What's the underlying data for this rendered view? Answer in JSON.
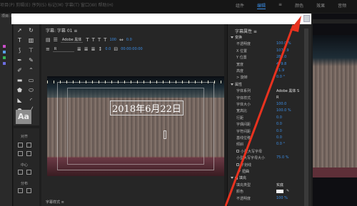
{
  "window": {
    "top_dim_text": "项目(P) 剪辑(E) 序列(S) 标记(M) 字幕(T) 窗口(W) 帮助(H)",
    "workspaces": [
      "组件",
      "编辑",
      "颜色",
      "效果",
      "音频"
    ],
    "active_workspace": "编辑",
    "workspace_menu_glyph": "≡",
    "overflow_glyph": "»"
  },
  "left_strip": {
    "label": "项目: l"
  },
  "tools": {
    "aa_label": "Aa"
  },
  "left_panel_2": {
    "labels": [
      "对齐",
      "中心",
      "分布"
    ]
  },
  "editor": {
    "header": "字幕: 字幕 01  ≡",
    "font_family": "Adobe 黑体",
    "font_style": "R",
    "size_value": "100",
    "kerning_value": "0.0",
    "leading_value": "0.0",
    "timecode": "00:00:00:00",
    "footer": "字幕样式  ≡"
  },
  "stage": {
    "title_text": "2018年6月22日"
  },
  "props": {
    "title": "字幕属性  ≡",
    "rows": [
      {
        "label": "变换",
        "type": "section"
      },
      {
        "label": "不透明度",
        "value": "100.0 %"
      },
      {
        "label": "X 位置",
        "value": "1079.9"
      },
      {
        "label": "Y 位置",
        "value": "285.0"
      },
      {
        "label": "宽度",
        "value": "479.8"
      },
      {
        "label": "高度",
        "value": "71.9"
      },
      {
        "label": "> 旋转",
        "value": "0.0 °"
      },
      {
        "label": "属性",
        "type": "section"
      },
      {
        "label": "字体系列",
        "value": "Adobe 黑体 S",
        "white": true
      },
      {
        "label": "字体样式",
        "value": "R",
        "white": true
      },
      {
        "label": "字体大小",
        "value": "100.0"
      },
      {
        "label": "宽高比",
        "value": "100.0 %"
      },
      {
        "label": "行距",
        "value": "0.0"
      },
      {
        "label": "字偶间距",
        "value": "0.0"
      },
      {
        "label": "字符间距",
        "value": "0.0"
      },
      {
        "label": "基线位移",
        "value": "0.0"
      },
      {
        "label": "倾斜",
        "value": "0.0 °"
      },
      {
        "label": "小型大写字母",
        "type": "check",
        "checked": false
      },
      {
        "label": "小型大写字母大小",
        "value": "75.0 %"
      },
      {
        "label": "下划线",
        "type": "check",
        "checked": false
      },
      {
        "label": "扭曲",
        "type": "subsection"
      },
      {
        "label": "填充",
        "type": "check-section",
        "checked": true
      },
      {
        "label": "填充类型",
        "value": "实底",
        "white": true
      },
      {
        "label": "颜色",
        "type": "color"
      },
      {
        "label": "不透明度",
        "value": "100 %"
      }
    ]
  },
  "colors": {
    "accent": "#3b8de5",
    "arrow": "#e8321f",
    "panel_bg": "#262626",
    "swatches": [
      "#c94fc8",
      "#5aa0e8",
      "#39b554",
      "#6d6de0"
    ]
  }
}
